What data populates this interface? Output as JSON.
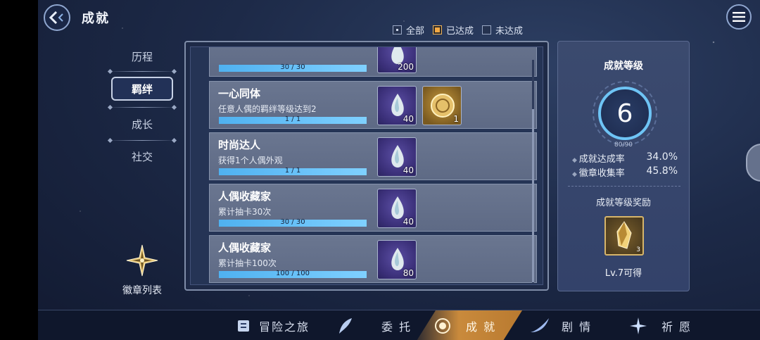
{
  "header": {
    "title": "成就"
  },
  "filters": [
    {
      "label": "全部",
      "state": "unchecked-dot"
    },
    {
      "label": "已达成",
      "state": "checked"
    },
    {
      "label": "未达成",
      "state": "unchecked"
    }
  ],
  "sidebar": {
    "items": [
      {
        "label": "历程"
      },
      {
        "label": "羁绊",
        "active": true
      },
      {
        "label": "成长"
      },
      {
        "label": "社交"
      }
    ],
    "badge_list_label": "徽章列表"
  },
  "achievements": [
    {
      "title": "",
      "desc": "",
      "progress": "30 / 30",
      "fraction": 1.0,
      "rewards": [
        {
          "type": "purple-gem",
          "count": "200"
        }
      ]
    },
    {
      "title": "一心同体",
      "desc": "任意人偶的羁绊等级达到2",
      "progress": "1 / 1",
      "fraction": 1.0,
      "rewards": [
        {
          "type": "purple-gem",
          "count": "40"
        },
        {
          "type": "gold-coin",
          "count": "1"
        }
      ]
    },
    {
      "title": "时尚达人",
      "desc": "获得1个人偶外观",
      "progress": "1 / 1",
      "fraction": 1.0,
      "rewards": [
        {
          "type": "purple-gem",
          "count": "40"
        }
      ]
    },
    {
      "title": "人偶收藏家",
      "desc": "累计抽卡30次",
      "progress": "30 / 30",
      "fraction": 1.0,
      "rewards": [
        {
          "type": "purple-gem",
          "count": "40"
        }
      ]
    },
    {
      "title": "人偶收藏家",
      "desc": "累计抽卡100次",
      "progress": "100 / 100",
      "fraction": 1.0,
      "rewards": [
        {
          "type": "purple-gem",
          "count": "80"
        }
      ]
    }
  ],
  "level_panel": {
    "title": "成就等级",
    "level": "6",
    "xp": "80/90",
    "stats": [
      {
        "label": "成就达成率",
        "value": "34.0%"
      },
      {
        "label": "徽章收集率",
        "value": "45.8%"
      }
    ],
    "reward_title": "成就等级奖励",
    "reward_count": "3",
    "reward_note": "Lv.7可得"
  },
  "bottom_nav": [
    {
      "label": "冒险之旅",
      "icon": "scroll-icon"
    },
    {
      "label": "委 托",
      "icon": "feather-icon"
    },
    {
      "label": "成 就",
      "icon": "medal-icon",
      "active": true
    },
    {
      "label": "剧 情",
      "icon": "wing-icon"
    },
    {
      "label": "祈 愿",
      "icon": "star-icon"
    }
  ]
}
